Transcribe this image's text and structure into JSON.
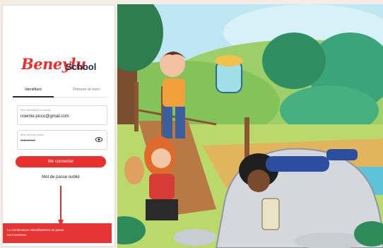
{
  "app": {
    "logo_text": "Beneylu",
    "logo_sub": "School"
  },
  "tabs": {
    "identifiant": "Identifiant",
    "prenom_nom": "Prénom et nom"
  },
  "form": {
    "email_label": "Mon identifiant ou email",
    "email_value": "noemie.picco@gmail.com",
    "password_label": "Mon mot de passe",
    "password_value": "••••••••••",
    "login_button": "Me connecter",
    "forgot_link": "Mot de passe oublié"
  },
  "error": {
    "line1": "La combinaison Identifiant/mot de passe",
    "line2": "est incorrecte."
  },
  "colors": {
    "brand_red": "#e8312f",
    "navy": "#1f2a44"
  }
}
